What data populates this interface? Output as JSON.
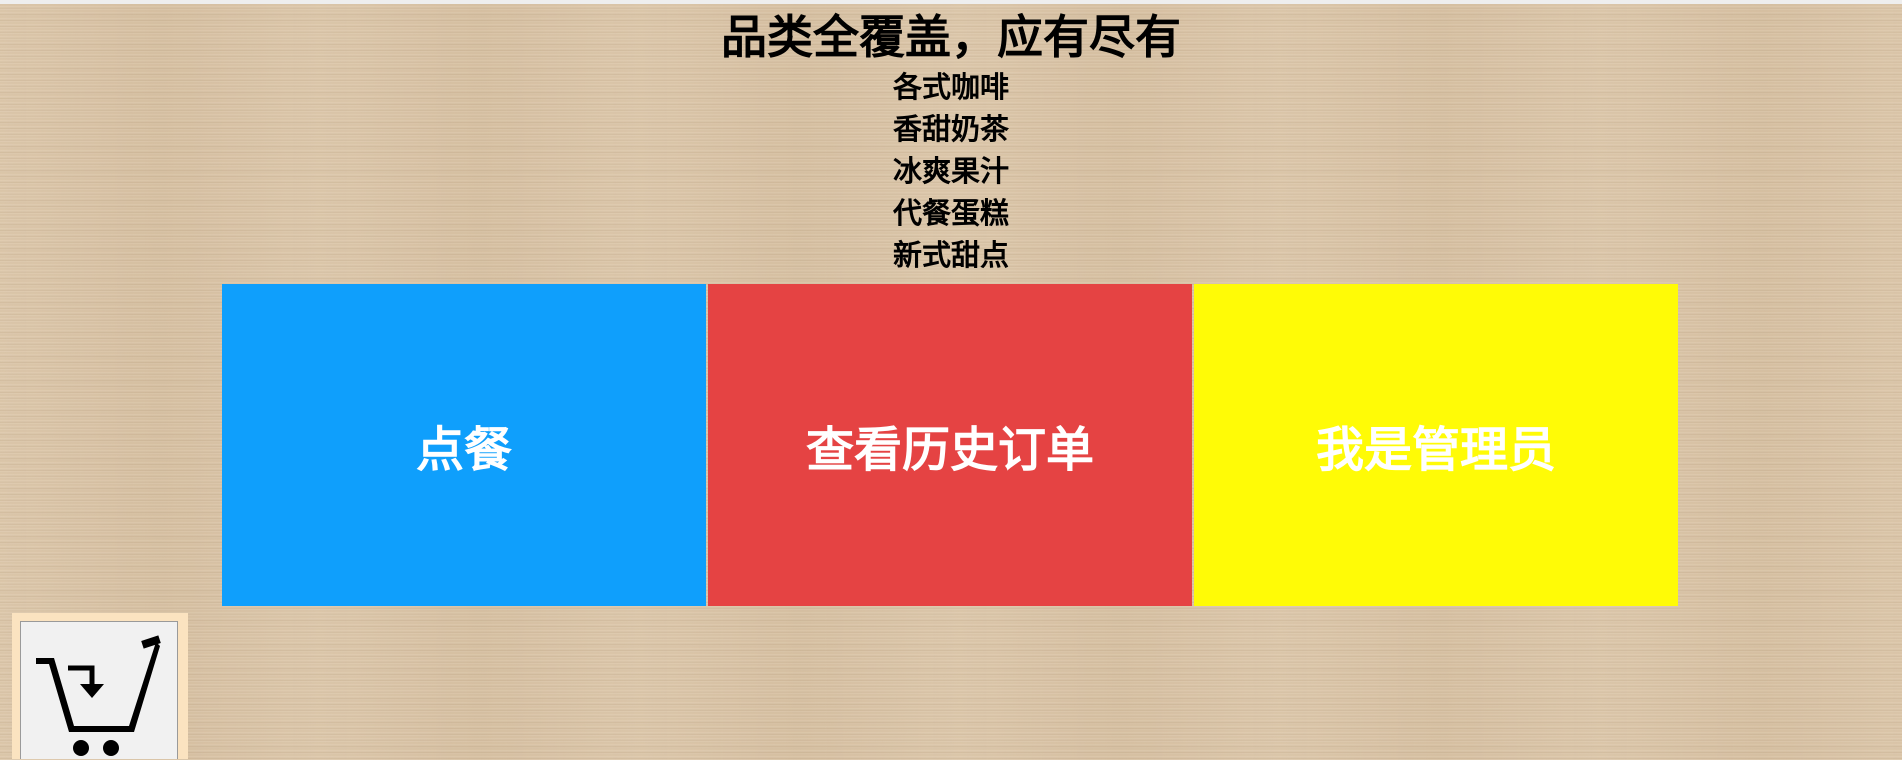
{
  "header": {
    "title": "品类全覆盖，应有尽有",
    "categories": [
      "各式咖啡",
      "香甜奶茶",
      "冰爽果汁",
      "代餐蛋糕",
      "新式甜点"
    ]
  },
  "actions": [
    {
      "label": "点餐",
      "color": "#0f9ffc"
    },
    {
      "label": "查看历史订单",
      "color": "#e54343"
    },
    {
      "label": "我是管理员",
      "color": "#fffb06"
    }
  ],
  "cart": {
    "icon": "shopping-cart-icon"
  }
}
